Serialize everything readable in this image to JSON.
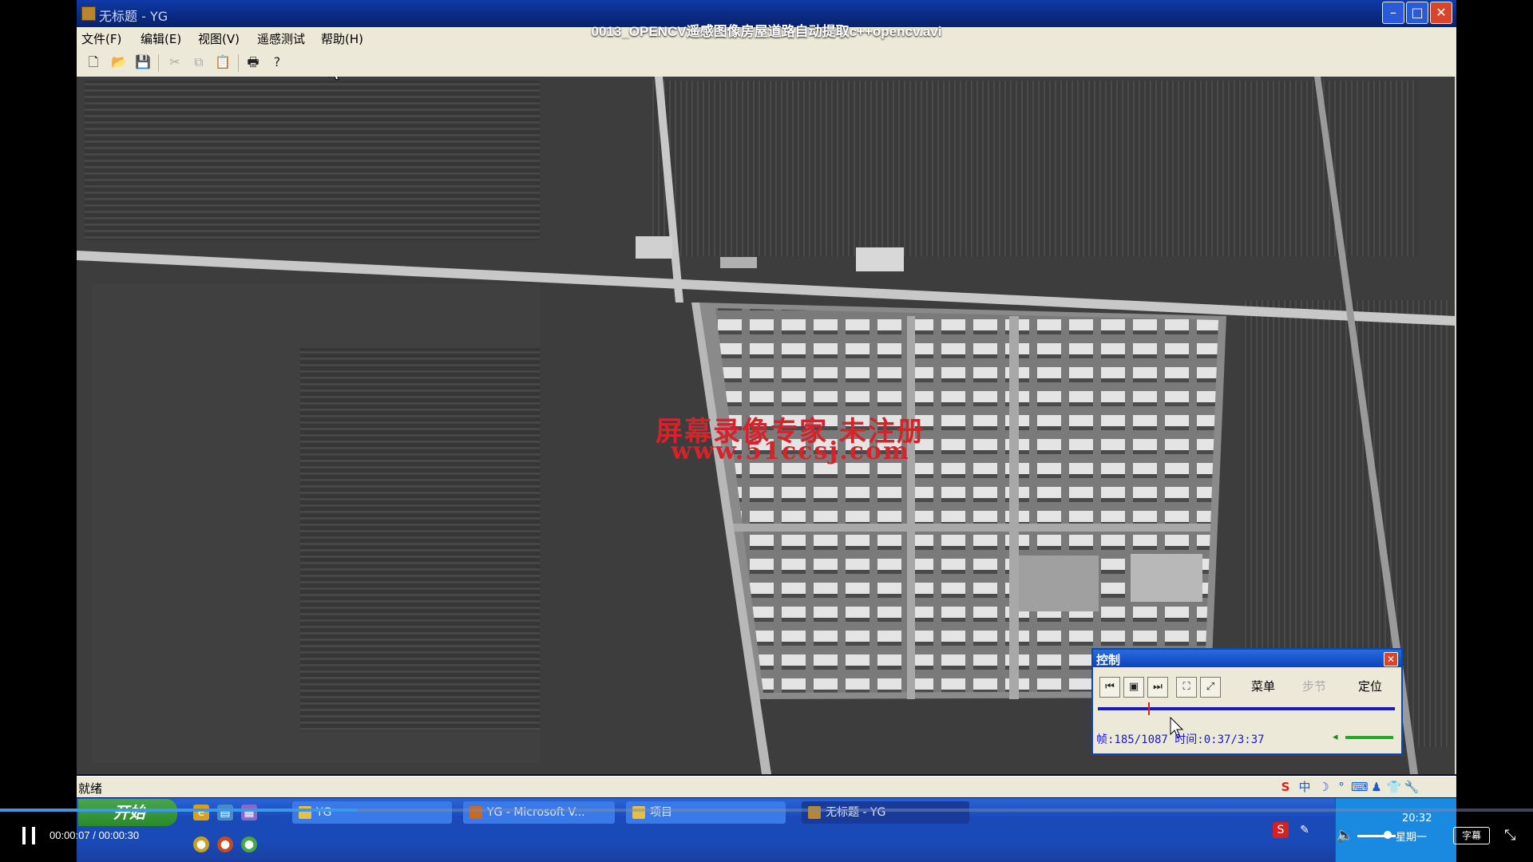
{
  "video": {
    "title": "0013_OPENCV遥感图像房屋道路自动提取c++opencv.avi",
    "time": "00:00:07 / 00:00:30",
    "progress": 0.233,
    "subtitle_label": "字幕",
    "volume": 0.8
  },
  "app": {
    "title": "无标题 - YG"
  },
  "menu": [
    "文件(F)",
    "编辑(E)",
    "视图(V)",
    "遥感测试",
    "帮助(H)"
  ],
  "toolbar": {
    "icons": [
      "new-file-icon",
      "open-folder-icon",
      "save-icon",
      "cut-icon",
      "copy-icon",
      "paste-icon",
      "print-icon",
      "help-icon"
    ]
  },
  "watermark": {
    "line1": "屏幕录像专家 未注册",
    "line2": "www.51ccsj.com"
  },
  "control_panel": {
    "title": "控制",
    "menu_label": "菜单",
    "step_label": "步节",
    "locate_label": "定位",
    "status": "帧:185/1087 时间:0:37/3:37",
    "playback_position": 0.17
  },
  "statusbar": {
    "text": "就绪"
  },
  "taskbar": {
    "start_label": "开始",
    "tasks": [
      "YG",
      "YG - Microsoft V...",
      "项目",
      "无标题 - YG"
    ],
    "clock": "20:32",
    "weekday": "星期一"
  },
  "colors": {
    "titlebar": "#0a2a80",
    "taskbar": "#1a4ab8",
    "watermark": "#d8222a",
    "control_track": "#1a1ac0"
  }
}
